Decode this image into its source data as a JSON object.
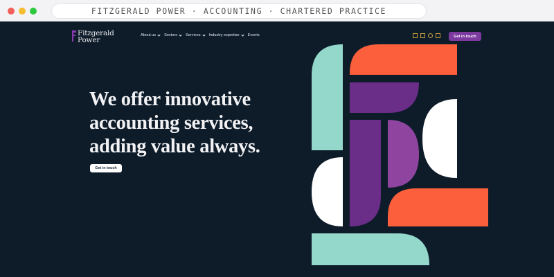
{
  "browser": {
    "url_text": "FITZGERALD POWER · ACCOUNTING · CHARTERED PRACTICE"
  },
  "header": {
    "logo_line1": "Fitzgerald",
    "logo_line2": "Power",
    "nav": [
      {
        "label": "About us",
        "has_dropdown": true
      },
      {
        "label": "Sectors",
        "has_dropdown": true
      },
      {
        "label": "Services",
        "has_dropdown": true
      },
      {
        "label": "Industry expertise",
        "has_dropdown": true
      },
      {
        "label": "Events",
        "has_dropdown": false
      }
    ],
    "utility_icons": [
      "phone-icon",
      "mail-icon",
      "user-icon",
      "calendar-icon"
    ],
    "cta_label": "Get in touch"
  },
  "hero": {
    "title_lines": [
      "We offer innovative",
      "accounting services,",
      "adding value always."
    ],
    "cta_label": "Get in touch"
  },
  "colors": {
    "background": "#0e1c2a",
    "mint": "#94d8cb",
    "orange": "#fb5f3c",
    "purple_dark": "#6a2d88",
    "purple_light": "#8f449f",
    "white": "#ffffff",
    "accent_gold": "#c9a23c",
    "cta_purple": "#7c3a9e"
  }
}
